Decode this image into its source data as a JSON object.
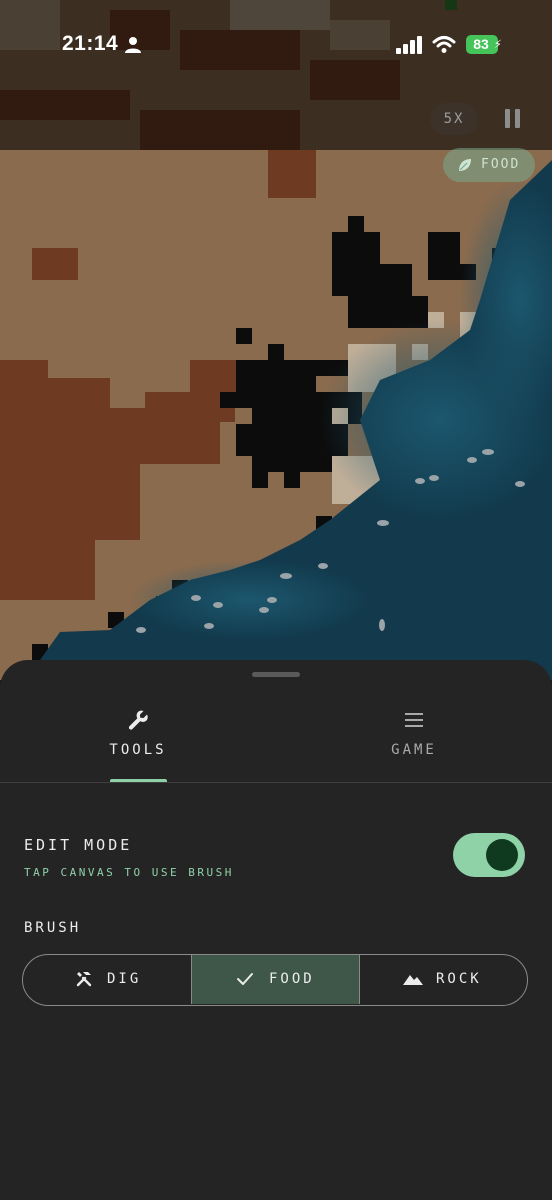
{
  "status_bar": {
    "time": "21:14",
    "battery_level": "83"
  },
  "game_hud": {
    "speed": "5X",
    "food_indicator": "FOOD"
  },
  "sheet": {
    "tabs": [
      {
        "label": "TOOLS",
        "icon": "wrench-icon",
        "active": true
      },
      {
        "label": "GAME",
        "icon": "menu-icon",
        "active": false
      }
    ],
    "edit_mode": {
      "title": "EDIT MODE",
      "subtitle": "TAP CANVAS TO USE BRUSH",
      "enabled": true
    },
    "brush": {
      "title": "BRUSH",
      "options": [
        {
          "label": "DIG",
          "icon": "tools-icon",
          "selected": false
        },
        {
          "label": "FOOD",
          "icon": "check-icon",
          "selected": true
        },
        {
          "label": "ROCK",
          "icon": "mountain-icon",
          "selected": false
        }
      ]
    }
  },
  "colors": {
    "accent": "#8fd2a8",
    "sheet_background": "#242424",
    "dirt": "#8a6b4e",
    "clay": "#6e3a22",
    "tunnel": "#0c0c0c",
    "water": "#123a4c",
    "rock": "#bfae98"
  }
}
